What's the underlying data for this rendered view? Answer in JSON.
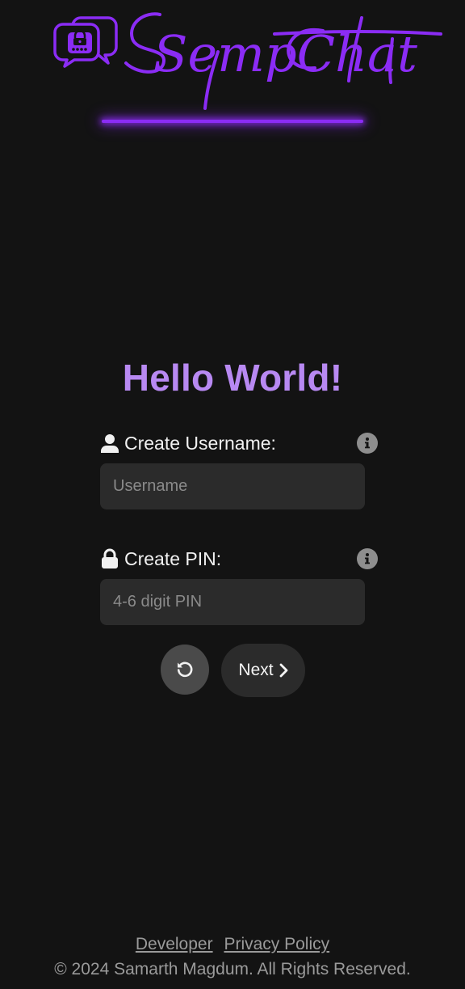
{
  "header": {
    "brand_name": "SempChat",
    "logo_icon": "chat-lock-icon",
    "accent_color": "#8b2cf5"
  },
  "form": {
    "heading": "Hello World!",
    "username": {
      "label": "Create Username:",
      "icon": "user-icon",
      "placeholder": "Username",
      "value": "",
      "info_icon": "info-icon"
    },
    "pin": {
      "label": "Create PIN:",
      "icon": "lock-icon",
      "placeholder": "4-6 digit PIN",
      "value": "",
      "info_icon": "info-icon"
    },
    "reset_icon": "reset-icon",
    "next_label": "Next",
    "next_icon": "chevron-right-icon",
    "heading_color": "#b889f2"
  },
  "footer": {
    "developer_link": "Developer",
    "privacy_link": "Privacy Policy",
    "copyright": "© 2024  Samarth Magdum.  All Rights Reserved."
  }
}
